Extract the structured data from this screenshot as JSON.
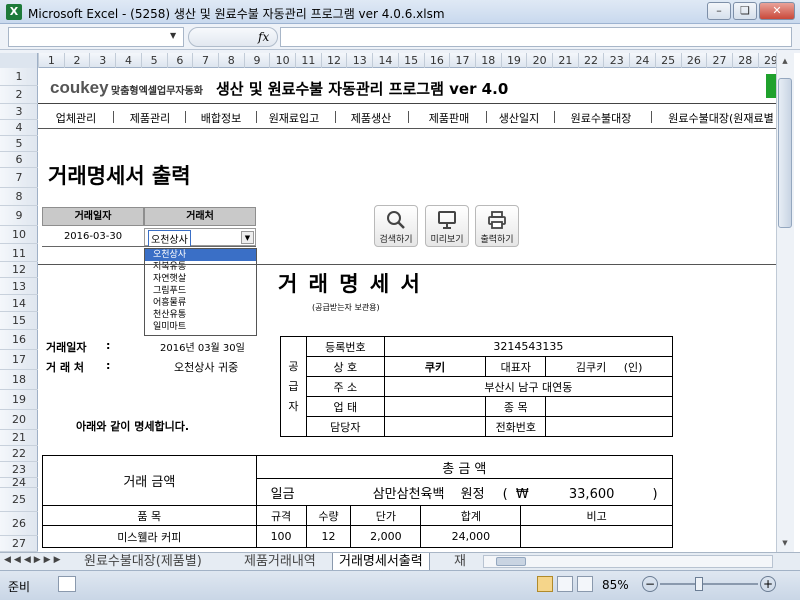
{
  "window": {
    "title": "Microsoft Excel - (5258) 생산 및 원료수불 자동관리 프로그램 ver 4.0.6.xlsm",
    "app_icon": "X"
  },
  "formula_bar": {
    "fx": "fx"
  },
  "columns": [
    "1",
    "2",
    "3",
    "4",
    "5",
    "6",
    "7",
    "8",
    "9",
    "10",
    "11",
    "12",
    "13",
    "14",
    "15",
    "16",
    "17",
    "18",
    "19",
    "20",
    "21",
    "22",
    "23",
    "24",
    "25",
    "26",
    "27",
    "28",
    "29"
  ],
  "rows": [
    "1",
    "2",
    "3",
    "4",
    "5",
    "6",
    "7",
    "8",
    "9",
    "10",
    "11",
    "12",
    "13",
    "14",
    "15",
    "16",
    "17",
    "18",
    "19",
    "20",
    "21",
    "22",
    "23",
    "24",
    "25",
    "26",
    "27"
  ],
  "header": {
    "brand": "coukey",
    "brand_sub": "맞춤형엑셀업무자동화",
    "program_title": "생산 및 원료수불 자동관리 프로그램 ver 4.0"
  },
  "menu": [
    "업체관리",
    "제품관리",
    "배합정보",
    "원재료입고",
    "제품생산",
    "제품판매",
    "생산일지",
    "원료수불대장",
    "원료수불대장(원재료별"
  ],
  "page_title": "거래명세서 출력",
  "filter": {
    "date_label": "거래일자",
    "client_label": "거래처",
    "date_value": "2016-03-30",
    "client_value": "오천상사",
    "dropdown_options": [
      "오천상사",
      "저복유통",
      "자연햇살",
      "그림푸드",
      "어흥물류",
      "천산유통",
      "일미마트"
    ]
  },
  "buttons": {
    "search": "검색하기",
    "preview": "미리보기",
    "print": "출력하기"
  },
  "doc": {
    "title": "거 래 명 세 서",
    "subtitle": "(공급받는자 보관용)",
    "date_label": "거래일자",
    "date_colon": ":",
    "date_value": "2016년 03월 30일",
    "client_label": "거 래 처",
    "client_colon": ":",
    "client_value": "오천상사 귀중",
    "notice": "아래와 같이 명세합니다.",
    "supplier_side": [
      "공",
      "급",
      "자"
    ],
    "reg_no_label": "등록번호",
    "reg_no": "3214543135",
    "company_label": "상  호",
    "company": "쿠키",
    "ceo_label": "대표자",
    "ceo": "김쿠키",
    "seal": "(인)",
    "address_label": "주  소",
    "address": "부산시 남구 대연동",
    "biz_type_label": "업  태",
    "biz_item_label": "종  목",
    "manager_label": "담당자",
    "phone_label": "전화번호",
    "amount_label": "거래 금액",
    "total_label": "총  금  액",
    "il_geum": "일금",
    "amount_words": "삼만삼천육백",
    "won_jeong": "원정",
    "open_paren": "(",
    "currency": "₩",
    "amount_num": "33,600",
    "close_paren": ")",
    "item_headers": [
      "품    목",
      "규격",
      "수량",
      "단가",
      "합계",
      "비고"
    ],
    "items": [
      {
        "name": "미스웰라 커피",
        "spec": "100",
        "qty": "12",
        "price": "2,000",
        "total": "24,000",
        "note": ""
      }
    ]
  },
  "sheet_tabs": [
    "원료수불대장(제품별)",
    "제품거래내역",
    "거래명세서출력",
    "재"
  ],
  "status": {
    "ready": "준비",
    "zoom": "85%"
  }
}
